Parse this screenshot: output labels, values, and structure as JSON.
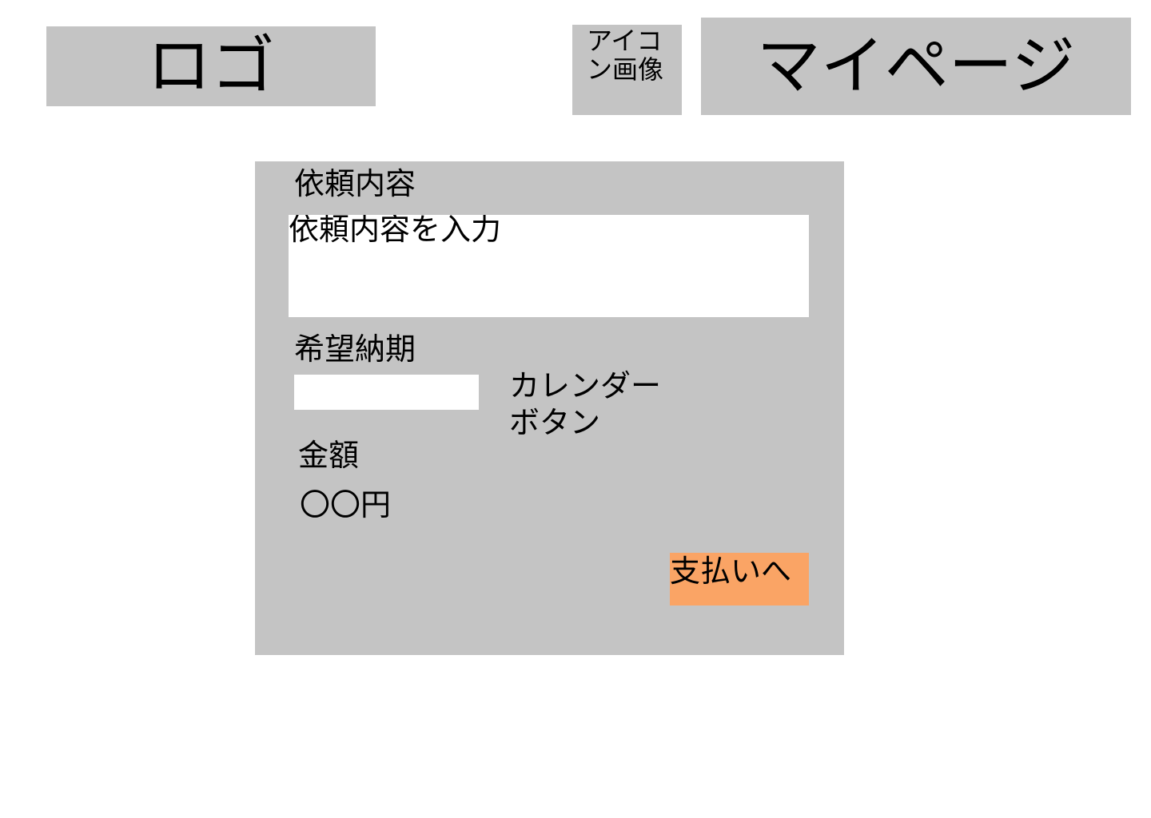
{
  "header": {
    "logo_label": "ロゴ",
    "icon_image_label": "アイコン画像",
    "mypage_label": "マイページ"
  },
  "form": {
    "request_label": "依頼内容",
    "request_placeholder": "依頼内容を入力",
    "deadline_label": "希望納期",
    "calendar_button_label": "カレンダーボタン",
    "amount_label": "金額",
    "amount_value": "〇〇円",
    "pay_button_label": "支払いへ"
  },
  "colors": {
    "panel_gray": "#c4c4c4",
    "input_white": "#ffffff",
    "pay_button_orange": "#faa465"
  }
}
